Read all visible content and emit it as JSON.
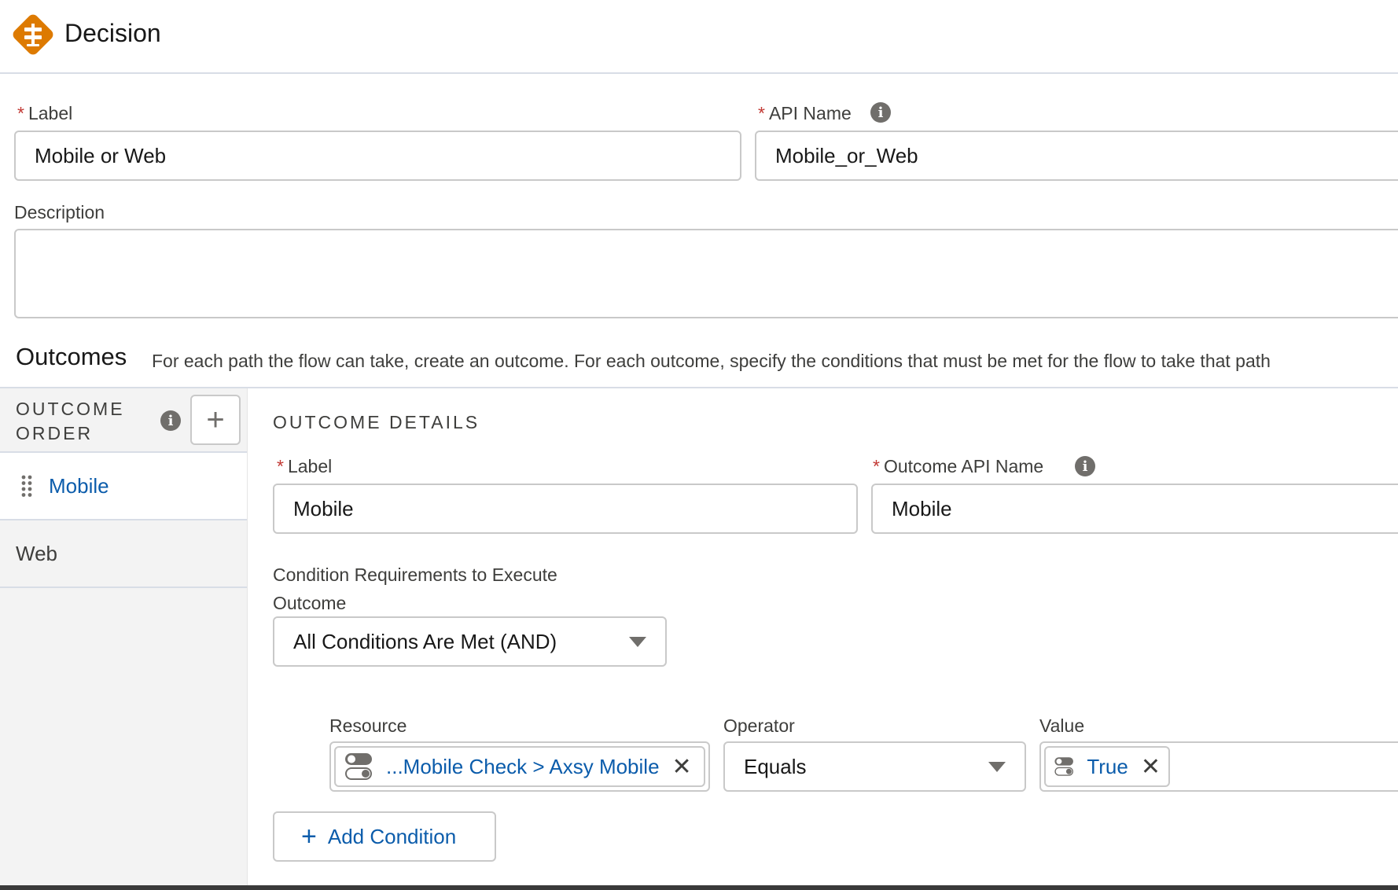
{
  "header": {
    "title": "Decision",
    "icon": "decision-icon",
    "accent_color": "#dd7a01"
  },
  "form": {
    "label_label": "Label",
    "label_value": "Mobile or Web",
    "api_name_label": "API Name",
    "api_name_value": "Mobile_or_Web",
    "description_label": "Description",
    "description_value": "",
    "required_mark": "*"
  },
  "outcomes": {
    "title": "Outcomes",
    "description": "For each path the flow can take, create an outcome. For each outcome, specify the conditions that must be met for the flow to take that path"
  },
  "outcome_order": {
    "heading": "OUTCOME ORDER",
    "add_icon": "plus-icon",
    "items": [
      {
        "label": "Mobile",
        "active": true
      },
      {
        "label": "Web",
        "active": false
      }
    ]
  },
  "outcome_details": {
    "heading": "OUTCOME DETAILS",
    "label_label": "Label",
    "label_value": "Mobile",
    "api_name_label": "Outcome API Name",
    "api_name_value": "Mobile",
    "condition_req_label_line1": "Condition Requirements to Execute",
    "condition_req_label_line2": "Outcome",
    "condition_req_value": "All Conditions Are Met (AND)"
  },
  "condition": {
    "resource_label": "Resource",
    "resource_value": "...Mobile Check > Axsy Mobile",
    "operator_label": "Operator",
    "operator_value": "Equals",
    "value_label": "Value",
    "value_value": "True",
    "add_condition_label": "Add Condition"
  },
  "colors": {
    "link": "#0b5cab",
    "required": "#c23934",
    "border": "#c9c9c9",
    "panel_bg": "#f3f3f3"
  }
}
